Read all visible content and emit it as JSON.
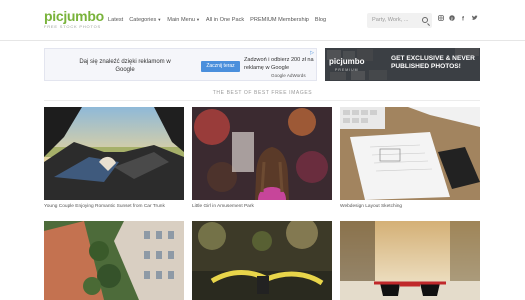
{
  "header": {
    "logo": "picjumbo",
    "tagline": "FREE STOCK PHOTOS",
    "nav": [
      {
        "label": "Latest",
        "caret": false
      },
      {
        "label": "Categories",
        "caret": true
      },
      {
        "label": "Main Menu",
        "caret": true
      },
      {
        "label": "All in One Pack",
        "caret": false
      },
      {
        "label": "PREMIUM Membership",
        "caret": false
      },
      {
        "label": "Blog",
        "caret": false
      }
    ],
    "search_placeholder": "Party, Work, ...",
    "social": [
      "instagram-icon",
      "pinterest-icon",
      "facebook-icon",
      "twitter-icon"
    ]
  },
  "ad_left": {
    "left_text": "Daj się znaleźć dzięki reklamom w Google",
    "button": "Zacznij teraz",
    "right_text": "Zadzwoń i odbierz 200 zł na reklamę w Google",
    "brand": "Google AdWords"
  },
  "ad_right": {
    "logo": "picjumbo",
    "sub": "PREMIUM",
    "headline": "GET EXCLUSIVE & NEVER PUBLISHED PHOTOS!"
  },
  "section_title": "THE BEST OF BEST FREE IMAGES",
  "photos": [
    {
      "caption": "Young Couple Enjoying Romantic Sunset from Car Trunk"
    },
    {
      "caption": "Little Girl in Amusement Park"
    },
    {
      "caption": "Webdesign Layout Sketching"
    },
    {
      "caption": ""
    },
    {
      "caption": ""
    },
    {
      "caption": ""
    }
  ],
  "colors": {
    "brand": "#79b33b"
  }
}
